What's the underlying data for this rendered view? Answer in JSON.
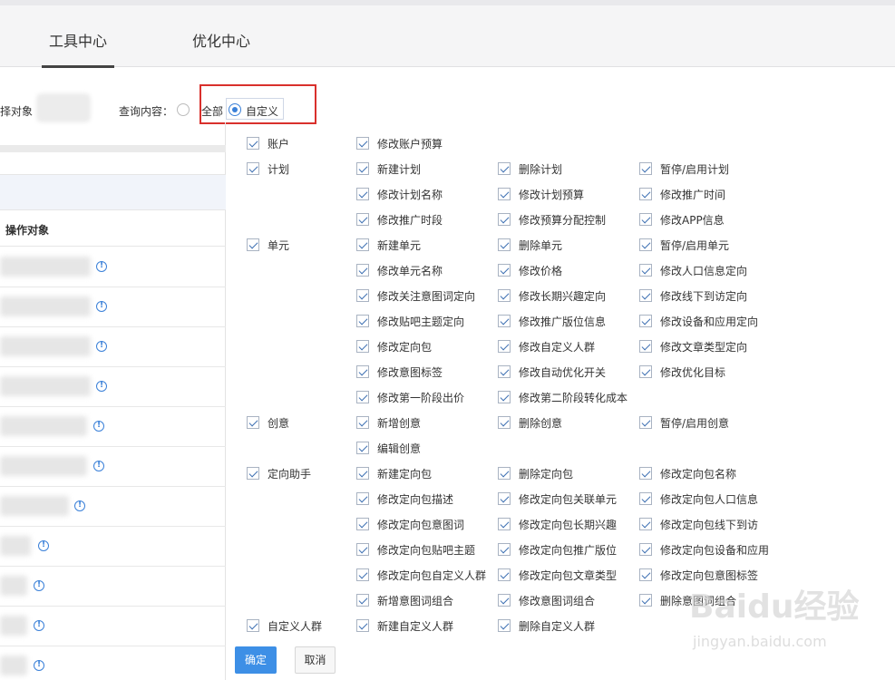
{
  "tabs": [
    {
      "label": "工具中心",
      "active": true
    },
    {
      "label": "优化中心",
      "active": false
    }
  ],
  "filter": {
    "object_label": "择对象",
    "query_label": "查询内容：",
    "option_all": "全部",
    "option_custom": "自定义",
    "selected": "自定义"
  },
  "left_table": {
    "header": "操作对象",
    "row_count": 11
  },
  "groups": [
    {
      "label": "账户",
      "items": [
        "修改账户预算"
      ]
    },
    {
      "label": "计划",
      "items": [
        "新建计划",
        "删除计划",
        "暂停/启用计划",
        "修改计划名称",
        "修改计划预算",
        "修改推广时间",
        "修改推广时段",
        "修改预算分配控制",
        "修改APP信息"
      ]
    },
    {
      "label": "单元",
      "items": [
        "新建单元",
        "删除单元",
        "暂停/启用单元",
        "修改单元名称",
        "修改价格",
        "修改人口信息定向",
        "修改关注意图词定向",
        "修改长期兴趣定向",
        "修改线下到访定向",
        "修改贴吧主题定向",
        "修改推广版位信息",
        "修改设备和应用定向",
        "修改定向包",
        "修改自定义人群",
        "修改文章类型定向",
        "修改意图标签",
        "修改自动优化开关",
        "修改优化目标",
        "修改第一阶段出价",
        "修改第二阶段转化成本"
      ]
    },
    {
      "label": "创意",
      "items": [
        "新增创意",
        "删除创意",
        "暂停/启用创意",
        "编辑创意"
      ]
    },
    {
      "label": "定向助手",
      "items": [
        "新建定向包",
        "删除定向包",
        "修改定向包名称",
        "修改定向包描述",
        "修改定向包关联单元",
        "修改定向包人口信息",
        "修改定向包意图词",
        "修改定向包长期兴趣",
        "修改定向包线下到访",
        "修改定向包贴吧主题",
        "修改定向包推广版位",
        "修改定向包设备和应用",
        "修改定向包自定义人群",
        "修改定向包文章类型",
        "修改定向包意图标签",
        "新增意图词组合",
        "修改意图词组合",
        "删除意图词组合"
      ]
    },
    {
      "label": "自定义人群",
      "items": [
        "新建自定义人群",
        "删除自定义人群"
      ]
    }
  ],
  "buttons": {
    "confirm": "确定",
    "cancel": "取消"
  },
  "watermark": {
    "brand": "Baidu经验",
    "url": "jingyan.baidu.com"
  },
  "colors": {
    "accent": "#3d8fe6",
    "highlight": "#d9302c",
    "checkbox": "#3d6fb2"
  }
}
